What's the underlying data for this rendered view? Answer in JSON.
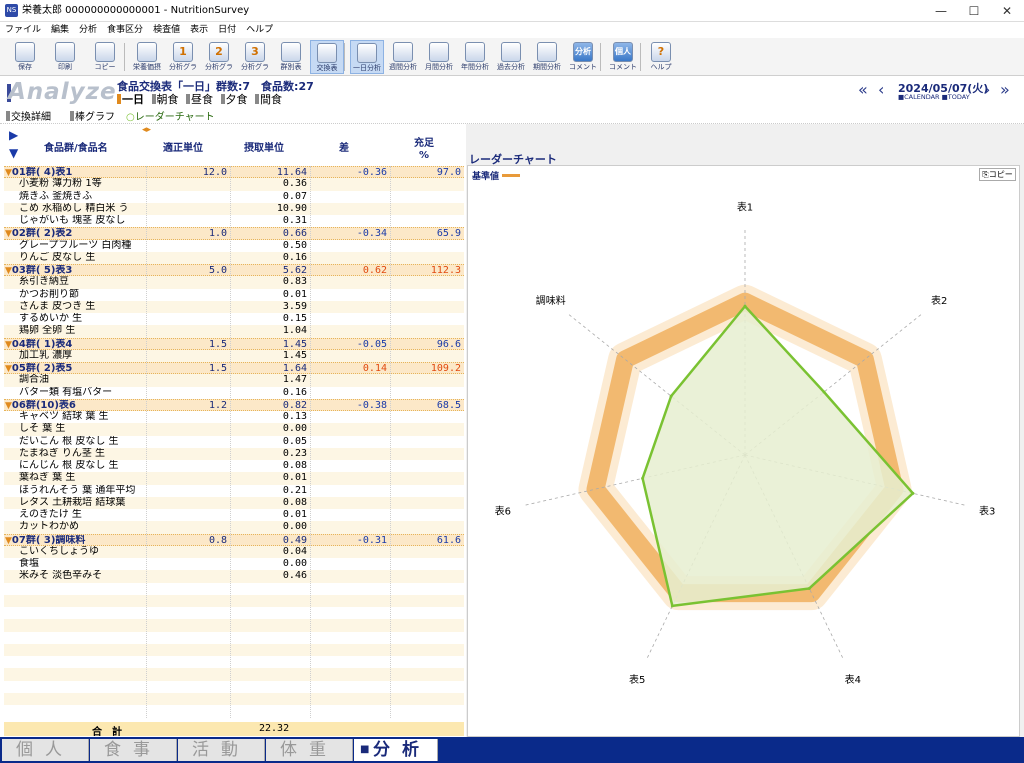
{
  "window": {
    "title": "栄養太郎 000000000000001 - NutritionSurvey",
    "minimize": "—",
    "maximize": "☐",
    "close": "✕"
  },
  "menu": [
    "ファイル",
    "編集",
    "分析",
    "食事区分",
    "検査値",
    "表示",
    "日付",
    "ヘルプ"
  ],
  "toolbar": {
    "buttons": [
      {
        "label": "保存",
        "glyph": ""
      },
      {
        "label": "印刷",
        "glyph": ""
      },
      {
        "label": "コピー",
        "glyph": ""
      },
      {
        "label": "栄養価摂",
        "glyph": ""
      },
      {
        "label": "分析グラ",
        "glyph": "1"
      },
      {
        "label": "分析グラ",
        "glyph": "2"
      },
      {
        "label": "分析グラ",
        "glyph": "3"
      },
      {
        "label": "群別表",
        "glyph": ""
      },
      {
        "label": "交換表",
        "glyph": ""
      },
      {
        "label": "一日分析",
        "glyph": ""
      },
      {
        "label": "週間分析",
        "glyph": ""
      },
      {
        "label": "月間分析",
        "glyph": ""
      },
      {
        "label": "年間分析",
        "glyph": ""
      },
      {
        "label": "過去分析",
        "glyph": ""
      },
      {
        "label": "期間分析",
        "glyph": ""
      },
      {
        "label": "コメント",
        "glyph": "分析"
      },
      {
        "label": "コメント",
        "glyph": "個人"
      },
      {
        "label": "ヘルプ",
        "glyph": "?"
      }
    ]
  },
  "header": {
    "logo": "Analyze",
    "summary": "食品交換表「一日」群数:7　食品数:27",
    "meals": [
      {
        "label": "一日",
        "active": true
      },
      {
        "label": "朝食",
        "active": false
      },
      {
        "label": "昼食",
        "active": false
      },
      {
        "label": "夕食",
        "active": false
      },
      {
        "label": "間食",
        "active": false
      }
    ]
  },
  "date": {
    "value": "2024/05/07(火)",
    "sub": "■CALENDAR ■TODAY",
    "prev2": "«",
    "prev": "‹",
    "next": "›",
    "next2": "»"
  },
  "views": [
    {
      "label": "交換詳細"
    },
    {
      "label": "棒グラフ"
    },
    {
      "label": "レーダーチャート"
    }
  ],
  "columns": {
    "name": "食品群/食品名",
    "std": "適正単位",
    "intake": "摂取単位",
    "diff": "差",
    "pct": "充足\n%"
  },
  "rows": [
    {
      "g": true,
      "name": "01群( 4)表1",
      "std": "12.0",
      "intake": "11.64",
      "diff": "-0.36",
      "pct": "97.0"
    },
    {
      "name": "小麦粉 薄力粉 1等",
      "intake": "0.36"
    },
    {
      "name": "焼きふ 釜焼きふ",
      "intake": "0.07"
    },
    {
      "name": "こめ 水稲めし 精白米 う",
      "intake": "10.90"
    },
    {
      "name": "じゃがいも 塊茎 皮なし",
      "intake": "0.31"
    },
    {
      "g": true,
      "name": "02群( 2)表2",
      "std": "1.0",
      "intake": "0.66",
      "diff": "-0.34",
      "pct": "65.9"
    },
    {
      "name": "グレープフルーツ 白肉種",
      "intake": "0.50"
    },
    {
      "name": "りんご 皮なし 生",
      "intake": "0.16"
    },
    {
      "g": true,
      "name": "03群( 5)表3",
      "std": "5.0",
      "intake": "5.62",
      "diff": "0.62",
      "pct": "112.3"
    },
    {
      "name": "糸引き納豆",
      "intake": "0.83"
    },
    {
      "name": "かつお削り節",
      "intake": "0.01"
    },
    {
      "name": "さんま 皮つき 生",
      "intake": "3.59"
    },
    {
      "name": "するめいか 生",
      "intake": "0.15"
    },
    {
      "name": "鶏卵 全卵 生",
      "intake": "1.04"
    },
    {
      "g": true,
      "name": "04群( 1)表4",
      "std": "1.5",
      "intake": "1.45",
      "diff": "-0.05",
      "pct": "96.6"
    },
    {
      "name": "加工乳 濃厚",
      "intake": "1.45"
    },
    {
      "g": true,
      "name": "05群( 2)表5",
      "std": "1.5",
      "intake": "1.64",
      "diff": "0.14",
      "pct": "109.2"
    },
    {
      "name": "調合油",
      "intake": "1.47"
    },
    {
      "name": "バター類 有塩バター",
      "intake": "0.16"
    },
    {
      "g": true,
      "name": "06群(10)表6",
      "std": "1.2",
      "intake": "0.82",
      "diff": "-0.38",
      "pct": "68.5"
    },
    {
      "name": "キャベツ 結球 葉 生",
      "intake": "0.13"
    },
    {
      "name": "しそ 葉 生",
      "intake": "0.00"
    },
    {
      "name": "だいこん 根 皮なし 生",
      "intake": "0.05"
    },
    {
      "name": "たまねぎ りん茎 生",
      "intake": "0.23"
    },
    {
      "name": "にんじん 根 皮なし 生",
      "intake": "0.08"
    },
    {
      "name": "葉ねぎ 葉 生",
      "intake": "0.01"
    },
    {
      "name": "ほうれんそう 葉 通年平均",
      "intake": "0.21"
    },
    {
      "name": "レタス 土耕栽培 結球葉",
      "intake": "0.08"
    },
    {
      "name": "えのきたけ 生",
      "intake": "0.01"
    },
    {
      "name": "カットわかめ",
      "intake": "0.00"
    },
    {
      "g": true,
      "name": "07群( 3)調味料",
      "std": "0.8",
      "intake": "0.49",
      "diff": "-0.31",
      "pct": "61.6"
    },
    {
      "name": "こいくちしょうゆ",
      "intake": "0.04"
    },
    {
      "name": "食塩",
      "intake": "0.00"
    },
    {
      "name": "米みそ 淡色辛みそ",
      "intake": "0.46"
    }
  ],
  "total": {
    "label": "合　計",
    "intake": "22.32"
  },
  "chart": {
    "title": "レーダーチャート",
    "legend": "基準値",
    "copy": "コピー"
  },
  "chart_data": {
    "type": "radar",
    "axes": [
      "表1",
      "表2",
      "表3",
      "表4",
      "表5",
      "表6",
      "調味料"
    ],
    "series": [
      {
        "name": "基準値",
        "values": [
          100,
          100,
          100,
          100,
          100,
          100,
          100
        ],
        "color": "#e89a3a"
      },
      {
        "values": [
          97.0,
          65.9,
          112.3,
          96.6,
          109.2,
          68.5,
          61.6
        ],
        "color": "#7ac232"
      }
    ],
    "rmax": 150
  },
  "tabs": [
    "個人",
    "食事",
    "活動",
    "体重",
    "分析"
  ],
  "active_tab": "分析"
}
